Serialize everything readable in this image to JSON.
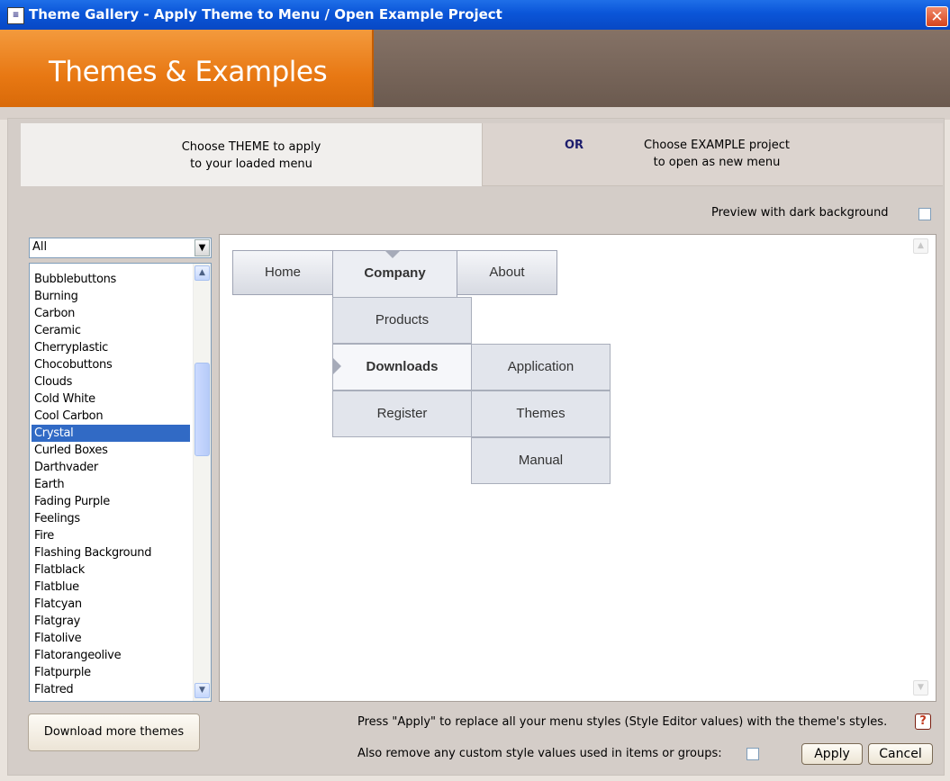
{
  "window": {
    "title": "Theme Gallery - Apply Theme to Menu / Open Example Project",
    "app_icon": "theme-gallery-app-icon",
    "close_glyph": "✕"
  },
  "header": {
    "title": "Themes & Examples"
  },
  "tabs": {
    "theme": {
      "line1": "Choose THEME to apply",
      "line2": "to your loaded menu"
    },
    "or": "OR",
    "example": {
      "line1": "Choose EXAMPLE project",
      "line2": "to open as new menu"
    }
  },
  "preview_dark_label": "Preview with dark background",
  "filter": {
    "selected": "All"
  },
  "themes": [
    "Bubblebuttons",
    "Burning",
    "Carbon",
    "Ceramic",
    "Cherryplastic",
    "Chocobuttons",
    "Clouds",
    "Cold White",
    "Cool Carbon",
    "Crystal",
    "Curled Boxes",
    "Darthvader",
    "Earth",
    "Fading Purple",
    "Feelings",
    "Fire",
    "Flashing Background",
    "Flatblack",
    "Flatblue",
    "Flatcyan",
    "Flatgray",
    "Flatolive",
    "Flatorangeolive",
    "Flatpurple",
    "Flatred"
  ],
  "selected_theme": "Crystal",
  "preview_menu": {
    "top": [
      "Home",
      "Company",
      "About"
    ],
    "company_sub": [
      "Products",
      "Downloads",
      "Register"
    ],
    "downloads_sub": [
      "Application",
      "Themes",
      "Manual"
    ]
  },
  "download_button": "Download more themes",
  "apply_note": "Press \"Apply\" to replace all your menu styles (Style Editor values) with the theme's styles.",
  "help_glyph": "?",
  "remove_custom_label": "Also remove any custom style values used in items or groups:",
  "apply_button": "Apply",
  "cancel_button": "Cancel",
  "colors": {
    "selection": "#316ac5",
    "header_orange": "#e87813",
    "header_brown": "#6b5a4f"
  }
}
